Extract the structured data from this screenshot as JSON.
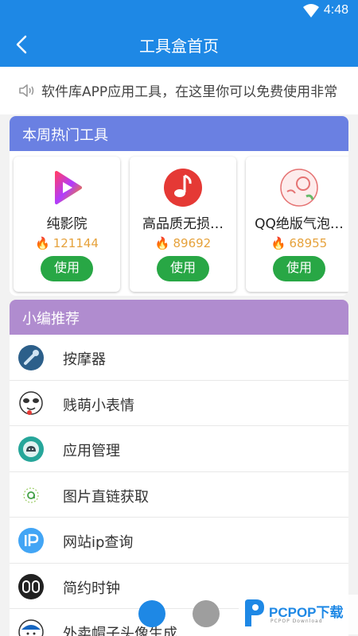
{
  "status_bar": {
    "time": "4:48",
    "wifi_icon": "wifi-icon"
  },
  "app_bar": {
    "title": "工具盒首页",
    "back_icon": "back-arrow-icon"
  },
  "notice": {
    "text": "软件库APP应用工具，在这里你可以免费使用非常",
    "icon": "speaker-icon"
  },
  "hot_tools": {
    "header": "本周热门工具",
    "items": [
      {
        "name": "纯影院",
        "count": "121144",
        "button": "使用",
        "icon": "video-play-icon"
      },
      {
        "name": "高品质无损…",
        "count": "89692",
        "button": "使用",
        "icon": "music-note-icon"
      },
      {
        "name": "QQ绝版气泡…",
        "count": "68955",
        "button": "使用",
        "icon": "bubble-icon"
      }
    ]
  },
  "recommend": {
    "header": "小编推荐",
    "items": [
      {
        "label": "按摩器",
        "icon": "massager-icon"
      },
      {
        "label": "贱萌小表情",
        "icon": "meme-face-icon"
      },
      {
        "label": "应用管理",
        "icon": "android-icon"
      },
      {
        "label": "图片直链获取",
        "icon": "image-link-icon"
      },
      {
        "label": "网站ip查询",
        "icon": "ip-icon"
      },
      {
        "label": "简约时钟",
        "icon": "clock-icon"
      },
      {
        "label": "外卖帽子头像生成",
        "icon": "avatar-hat-icon"
      }
    ]
  },
  "watermark": {
    "text": "PCPOP下载",
    "sub": "PCPOP Download"
  },
  "colors": {
    "primary": "#1e88e5",
    "hot_header": "#6a80e2",
    "rec_header": "#b08ccf",
    "use_button": "#28a745"
  }
}
